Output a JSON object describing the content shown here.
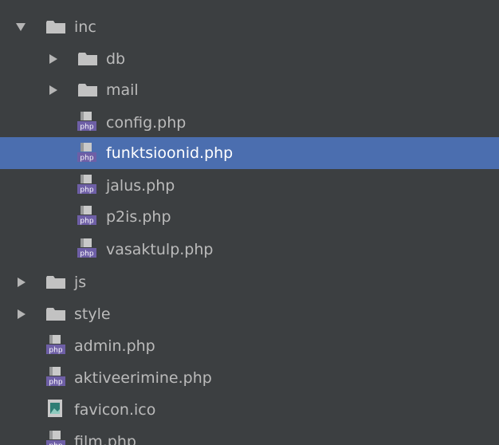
{
  "tree": {
    "items": [
      {
        "label": "inc",
        "type": "folder",
        "state": "expanded",
        "depth": 0
      },
      {
        "label": "db",
        "type": "folder",
        "state": "collapsed",
        "depth": 1
      },
      {
        "label": "mail",
        "type": "folder",
        "state": "collapsed",
        "depth": 1
      },
      {
        "label": "config.php",
        "type": "php",
        "depth": 2
      },
      {
        "label": "funktsioonid.php",
        "type": "php",
        "depth": 2,
        "selected": true
      },
      {
        "label": "jalus.php",
        "type": "php",
        "depth": 2
      },
      {
        "label": "p2is.php",
        "type": "php",
        "depth": 2
      },
      {
        "label": "vasaktulp.php",
        "type": "php",
        "depth": 2
      },
      {
        "label": "js",
        "type": "folder",
        "state": "collapsed",
        "depth": 0
      },
      {
        "label": "style",
        "type": "folder",
        "state": "collapsed",
        "depth": 0
      },
      {
        "label": "admin.php",
        "type": "php",
        "depth": 1
      },
      {
        "label": "aktiveerimine.php",
        "type": "php",
        "depth": 1
      },
      {
        "label": "favicon.ico",
        "type": "image",
        "depth": 1
      },
      {
        "label": "film.php",
        "type": "php",
        "depth": 1
      }
    ]
  },
  "icons": {
    "php_badge_text": "php"
  },
  "colors": {
    "background": "#3c3f41",
    "selection": "#4b6eaf",
    "text": "#bbbbbb",
    "folder": "#c2c2c2",
    "php_badge": "#6e5fa6"
  }
}
